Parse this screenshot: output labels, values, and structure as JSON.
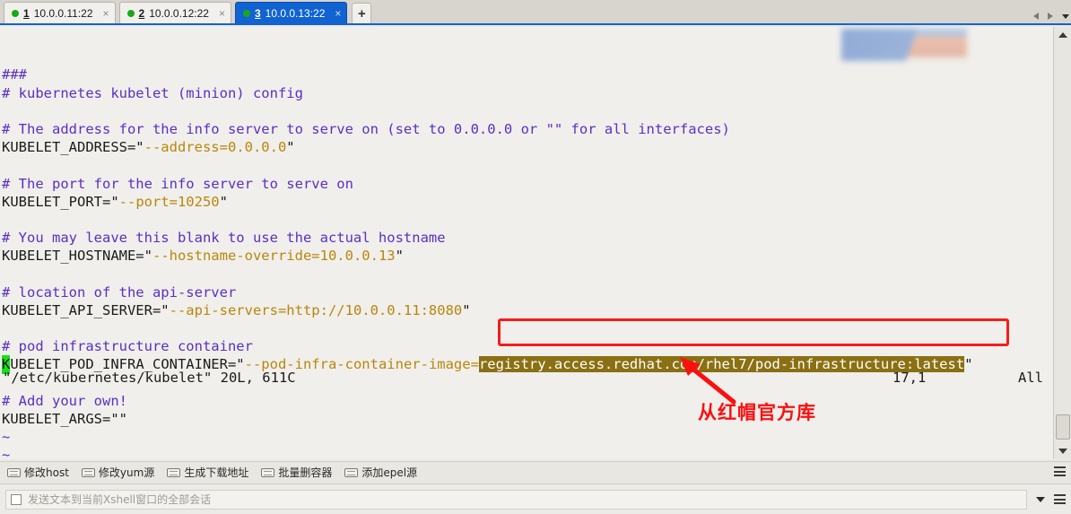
{
  "tabs": [
    {
      "num": "1",
      "label": "10.0.0.11:22",
      "active": false,
      "status_color": "#1aa81a",
      "close": "×"
    },
    {
      "num": "2",
      "label": "10.0.0.12:22",
      "active": false,
      "status_color": "#1aa81a",
      "close": "×"
    },
    {
      "num": "3",
      "label": "10.0.0.13:22",
      "active": true,
      "status_color": "#1aa81a",
      "close": "×"
    }
  ],
  "tab_add_label": "+",
  "terminal": {
    "lines": [
      {
        "segments": [
          {
            "text": "###",
            "style": "cm"
          }
        ]
      },
      {
        "segments": [
          {
            "text": "# kubernetes kubelet (minion) config",
            "style": "cm"
          }
        ]
      },
      {
        "segments": [
          {
            "text": "",
            "style": "pl"
          }
        ]
      },
      {
        "segments": [
          {
            "text": "# The address for the info server to serve on (set to 0.0.0.0 or \"\" for all interfaces)",
            "style": "cm"
          }
        ]
      },
      {
        "segments": [
          {
            "text": "KUBELET_ADDRESS=\"",
            "style": "pl"
          },
          {
            "text": "--address=0.0.0.0",
            "style": "st"
          },
          {
            "text": "\"",
            "style": "pl"
          }
        ]
      },
      {
        "segments": [
          {
            "text": "",
            "style": "pl"
          }
        ]
      },
      {
        "segments": [
          {
            "text": "# The port for the info server to serve on",
            "style": "cm"
          }
        ]
      },
      {
        "segments": [
          {
            "text": "KUBELET_PORT=\"",
            "style": "pl"
          },
          {
            "text": "--port=10250",
            "style": "st"
          },
          {
            "text": "\"",
            "style": "pl"
          }
        ]
      },
      {
        "segments": [
          {
            "text": "",
            "style": "pl"
          }
        ]
      },
      {
        "segments": [
          {
            "text": "# You may leave this blank to use the actual hostname",
            "style": "cm"
          }
        ]
      },
      {
        "segments": [
          {
            "text": "KUBELET_HOSTNAME=\"",
            "style": "pl"
          },
          {
            "text": "--hostname-override=10.0.0.13",
            "style": "st"
          },
          {
            "text": "\"",
            "style": "pl"
          }
        ]
      },
      {
        "segments": [
          {
            "text": "",
            "style": "pl"
          }
        ]
      },
      {
        "segments": [
          {
            "text": "# location of the api-server",
            "style": "cm"
          }
        ]
      },
      {
        "segments": [
          {
            "text": "KUBELET_API_SERVER=\"",
            "style": "pl"
          },
          {
            "text": "--api-servers=http://10.0.0.11:8080",
            "style": "st"
          },
          {
            "text": "\"",
            "style": "pl"
          }
        ]
      },
      {
        "segments": [
          {
            "text": "",
            "style": "pl"
          }
        ]
      },
      {
        "segments": [
          {
            "text": "# pod infrastructure container",
            "style": "cm"
          }
        ]
      },
      {
        "segments": [
          {
            "text": "K",
            "style": "cursor"
          },
          {
            "text": "UBELET_POD_INFRA_CONTAINER=\"",
            "style": "pl"
          },
          {
            "text": "--pod-infra-container-image=",
            "style": "st"
          },
          {
            "text": "registry.access.redhat.com/rhel7/pod-infrastructure:latest",
            "style": "selhl"
          },
          {
            "text": "\"",
            "style": "pl"
          }
        ]
      },
      {
        "segments": [
          {
            "text": "",
            "style": "pl"
          }
        ]
      },
      {
        "segments": [
          {
            "text": "# Add your own!",
            "style": "cm"
          }
        ]
      },
      {
        "segments": [
          {
            "text": "KUBELET_ARGS=\"\"",
            "style": "pl"
          }
        ]
      },
      {
        "segments": [
          {
            "text": "~",
            "style": "tl"
          }
        ]
      },
      {
        "segments": [
          {
            "text": "~",
            "style": "tl"
          }
        ]
      }
    ],
    "status_file": "\"/etc/kubernetes/kubelet\" 20L, 611C",
    "status_position": "17,1",
    "status_scroll": "All"
  },
  "annotation": {
    "text": "从红帽官方库",
    "color": "#fb1010",
    "highlight_box_color": "#f71c1c"
  },
  "shortcuts": {
    "items": [
      {
        "label": "修改host"
      },
      {
        "label": "修改yum源"
      },
      {
        "label": "生成下载地址"
      },
      {
        "label": "批量删容器"
      },
      {
        "label": "添加epel源"
      }
    ]
  },
  "sendbar": {
    "placeholder": "发送文本到当前Xshell窗口的全部会话",
    "value": ""
  }
}
